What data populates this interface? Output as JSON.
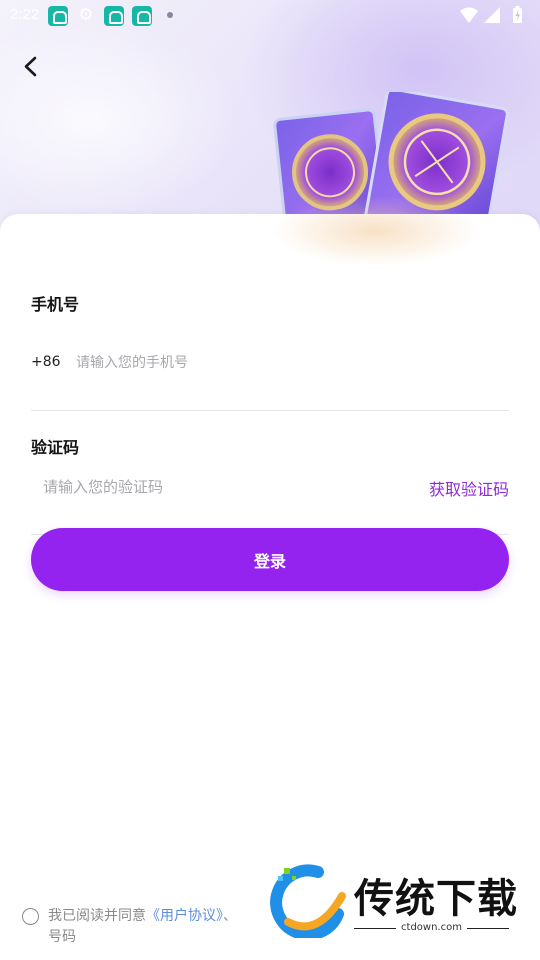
{
  "status_bar": {
    "time": "2:22",
    "icons": [
      "app-icon",
      "gear-icon",
      "app-icon",
      "app-icon",
      "notification-dot-icon"
    ],
    "right_icons": [
      "wifi-icon",
      "signal-icon",
      "battery-charging-icon"
    ]
  },
  "form": {
    "phone_label": "手机号",
    "country_code": "+86",
    "phone_placeholder": "请输入您的手机号",
    "code_label": "验证码",
    "code_placeholder": "请输入您的验证码",
    "get_code_label": "获取验证码",
    "login_label": "登录"
  },
  "agreement": {
    "prefix": "我已阅读并同意",
    "user_agreement": "《用户协议》",
    "separator": "、",
    "suffix": "号码"
  },
  "watermark": {
    "title": "传统下载",
    "url": "ctdown.com"
  },
  "colors": {
    "primary": "#9423f0",
    "link": "#5b8ee0",
    "accent_text": "#8e2bd9"
  }
}
